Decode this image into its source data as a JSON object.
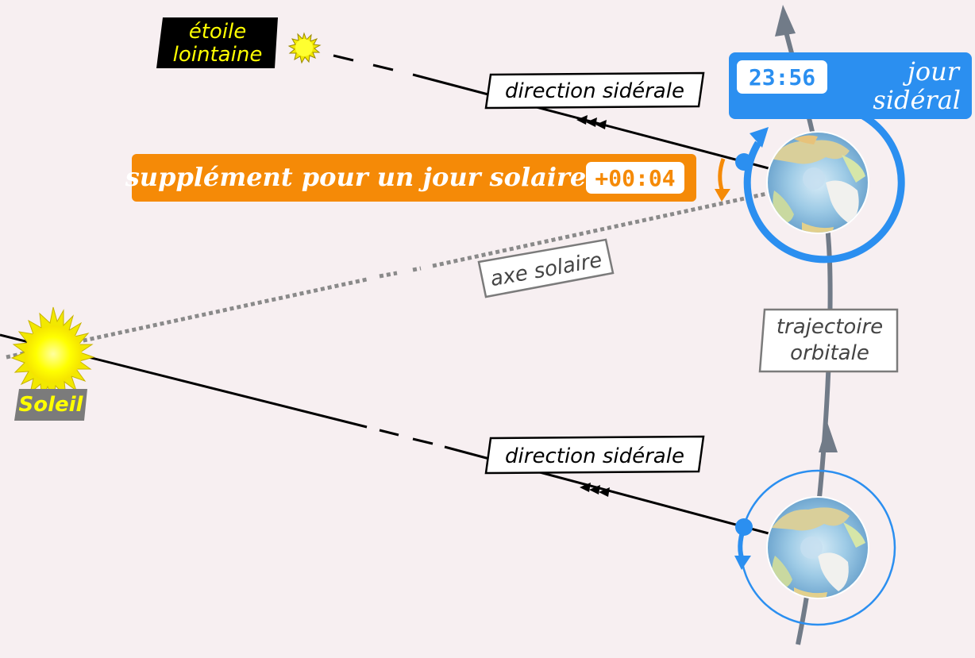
{
  "labels": {
    "distant_star": [
      "étoile",
      "lointaine"
    ],
    "sidereal_direction_top": "direction sidérale",
    "sidereal_direction_bottom": "direction sidérale",
    "solar_supplement": "supplément pour un jour solaire",
    "supplement_time": "+00:04",
    "sidereal_day_time": "23:56",
    "sidereal_day": [
      "jour",
      "sidéral"
    ],
    "solar_axis": "axe solaire",
    "orbital_path": [
      "trajectoire",
      "orbitale"
    ],
    "sun": "Soleil"
  },
  "colors": {
    "background": "#f7eff1",
    "sidereal_blue": "#2b8ff0",
    "supplement_orange": "#f58a07",
    "orbit_grey": "#717b88",
    "sun_yellow": "#ffff00",
    "label_black": "#000000",
    "sun_label_grey": "#7b7b7b",
    "star_label_text": "#ffff00",
    "sun_label_text": "#ffff00"
  },
  "icons": {
    "sun": "sun-icon",
    "distant_star": "star-icon",
    "earth": "earth-polar-view-icon",
    "rotation_marker": "dot-icon"
  }
}
